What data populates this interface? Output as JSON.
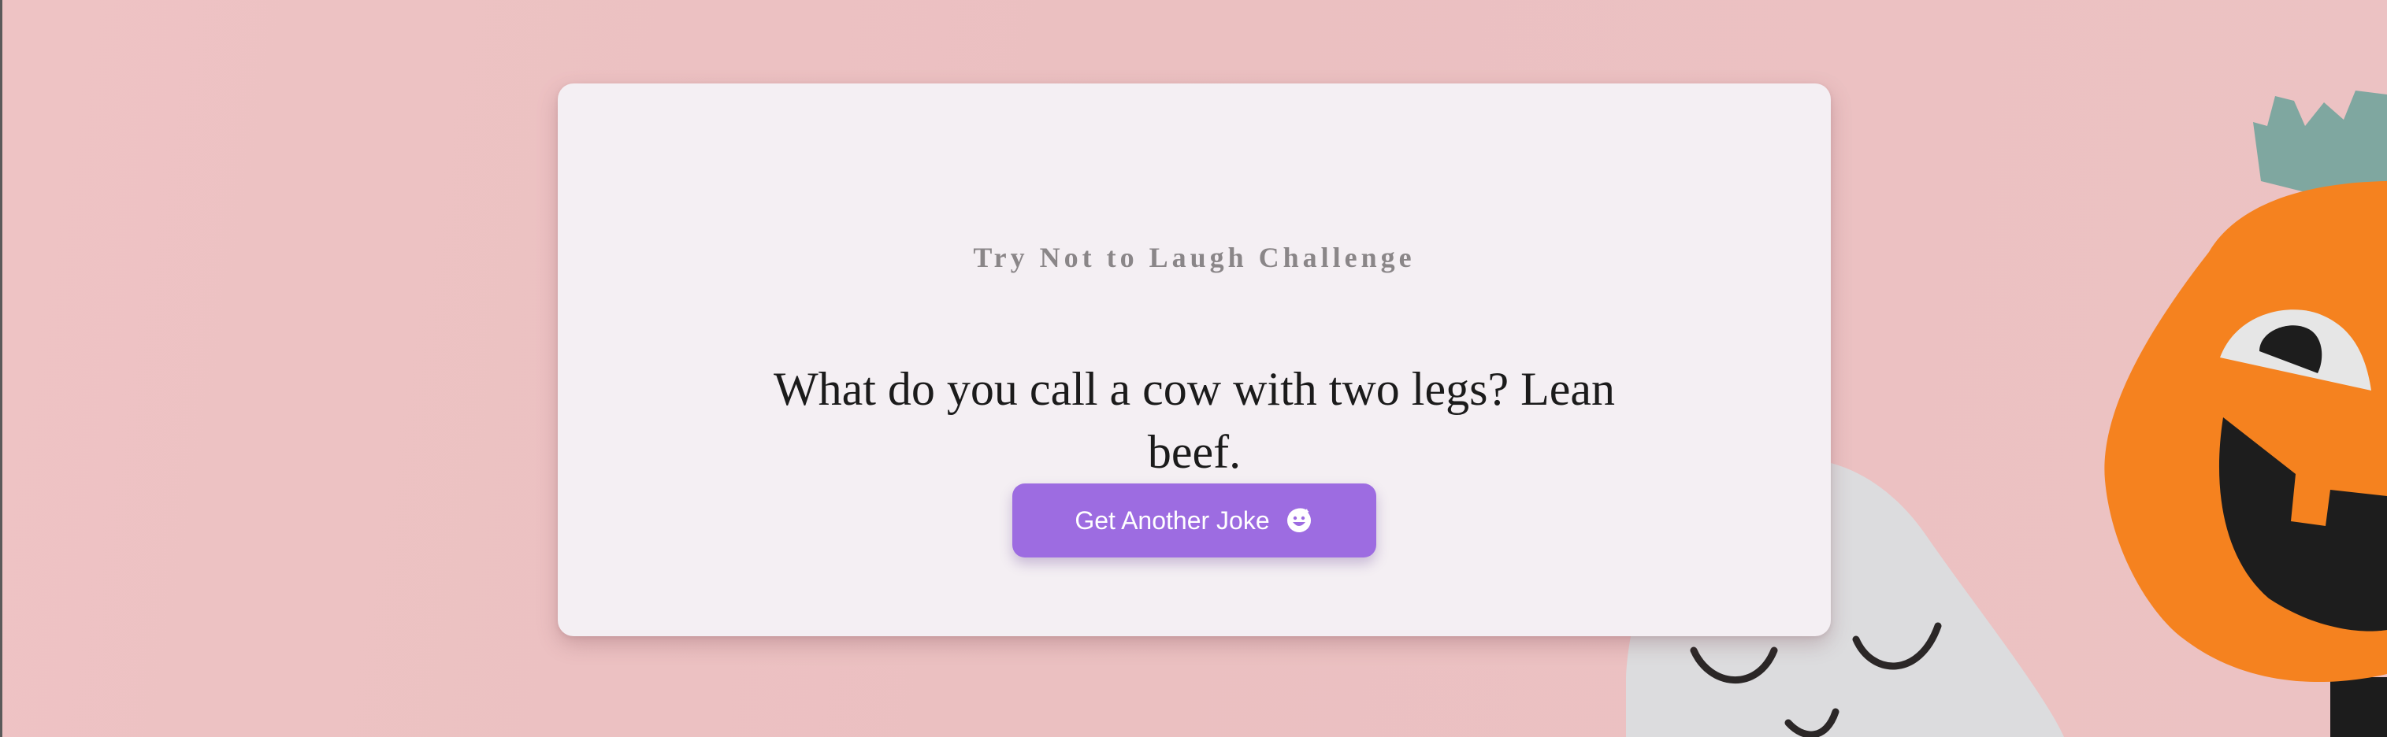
{
  "page": {
    "title": "Try Not to Laugh Challenge",
    "joke": "What do you call a cow with two legs? Lean beef.",
    "button_label": "Get Another Joke",
    "button_icon": "refresh-laugh-icon"
  },
  "colors": {
    "background": "#ecc1c2",
    "card": "#f4eff3",
    "button": "#9d6ce1",
    "title_text": "#8a8688",
    "joke_text": "#1b1b1b",
    "pumpkin": "#f5821f",
    "ghost": "#dcdcde"
  }
}
